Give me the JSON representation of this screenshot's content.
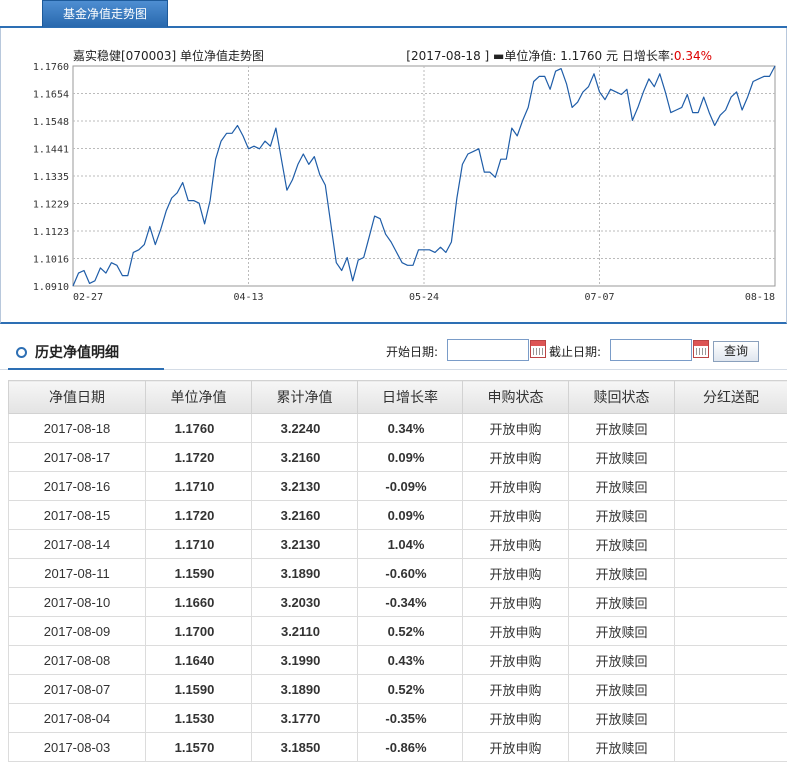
{
  "tab": {
    "label": "基金净值走势图"
  },
  "chart_header": {
    "title": "嘉实稳健[070003] 单位净值走势图",
    "info_prefix": "[2017-08-18 ] ▬单位净值: 1.1760 元  日增长率:",
    "info_rate": "0.34%"
  },
  "chart_data": {
    "type": "line",
    "title": "嘉实稳健[070003] 单位净值走势图",
    "ylim": [
      1.091,
      1.176
    ],
    "y_ticks": [
      "1.1760",
      "1.1654",
      "1.1548",
      "1.1441",
      "1.1335",
      "1.1229",
      "1.1123",
      "1.1016",
      "1.0910"
    ],
    "x_ticks": [
      "02-27",
      "04-13",
      "05-24",
      "07-07",
      "08-18"
    ],
    "grid": true,
    "series": [
      {
        "name": "单位净值",
        "color": "#1f5da8",
        "values": [
          1.091,
          1.096,
          1.097,
          1.092,
          1.093,
          1.098,
          1.096,
          1.1,
          1.099,
          1.095,
          1.095,
          1.104,
          1.105,
          1.107,
          1.114,
          1.107,
          1.113,
          1.12,
          1.125,
          1.127,
          1.131,
          1.124,
          1.124,
          1.123,
          1.115,
          1.124,
          1.14,
          1.147,
          1.15,
          1.15,
          1.153,
          1.149,
          1.144,
          1.145,
          1.144,
          1.147,
          1.145,
          1.152,
          1.14,
          1.128,
          1.132,
          1.138,
          1.142,
          1.138,
          1.141,
          1.134,
          1.13,
          1.115,
          1.1,
          1.097,
          1.102,
          1.093,
          1.101,
          1.102,
          1.11,
          1.118,
          1.117,
          1.111,
          1.108,
          1.104,
          1.1,
          1.099,
          1.099,
          1.105,
          1.105,
          1.105,
          1.104,
          1.106,
          1.104,
          1.108,
          1.125,
          1.138,
          1.142,
          1.143,
          1.144,
          1.135,
          1.135,
          1.133,
          1.14,
          1.14,
          1.152,
          1.149,
          1.155,
          1.16,
          1.17,
          1.172,
          1.172,
          1.167,
          1.174,
          1.175,
          1.169,
          1.16,
          1.162,
          1.166,
          1.168,
          1.173,
          1.166,
          1.163,
          1.167,
          1.166,
          1.165,
          1.167,
          1.155,
          1.16,
          1.166,
          1.171,
          1.168,
          1.173,
          1.166,
          1.158,
          1.159,
          1.16,
          1.165,
          1.158,
          1.158,
          1.164,
          1.158,
          1.153,
          1.157,
          1.159,
          1.164,
          1.166,
          1.159,
          1.164,
          1.17,
          1.171,
          1.172,
          1.172,
          1.176
        ]
      }
    ]
  },
  "history": {
    "title": "历史净值明细",
    "start_label": "开始日期:",
    "end_label": "截止日期:",
    "start_value": "",
    "end_value": "",
    "query_label": "查询",
    "columns": [
      "净值日期",
      "单位净值",
      "累计净值",
      "日增长率",
      "申购状态",
      "赎回状态",
      "分红送配"
    ],
    "rows": [
      {
        "date": "2017-08-18",
        "nav": "1.1760",
        "acc": "3.2240",
        "rate": "0.34%",
        "dir": "up",
        "buy": "开放申购",
        "sell": "开放赎回",
        "div": ""
      },
      {
        "date": "2017-08-17",
        "nav": "1.1720",
        "acc": "3.2160",
        "rate": "0.09%",
        "dir": "up",
        "buy": "开放申购",
        "sell": "开放赎回",
        "div": ""
      },
      {
        "date": "2017-08-16",
        "nav": "1.1710",
        "acc": "3.2130",
        "rate": "-0.09%",
        "dir": "down",
        "buy": "开放申购",
        "sell": "开放赎回",
        "div": ""
      },
      {
        "date": "2017-08-15",
        "nav": "1.1720",
        "acc": "3.2160",
        "rate": "0.09%",
        "dir": "up",
        "buy": "开放申购",
        "sell": "开放赎回",
        "div": ""
      },
      {
        "date": "2017-08-14",
        "nav": "1.1710",
        "acc": "3.2130",
        "rate": "1.04%",
        "dir": "up",
        "buy": "开放申购",
        "sell": "开放赎回",
        "div": ""
      },
      {
        "date": "2017-08-11",
        "nav": "1.1590",
        "acc": "3.1890",
        "rate": "-0.60%",
        "dir": "down",
        "buy": "开放申购",
        "sell": "开放赎回",
        "div": ""
      },
      {
        "date": "2017-08-10",
        "nav": "1.1660",
        "acc": "3.2030",
        "rate": "-0.34%",
        "dir": "down",
        "buy": "开放申购",
        "sell": "开放赎回",
        "div": ""
      },
      {
        "date": "2017-08-09",
        "nav": "1.1700",
        "acc": "3.2110",
        "rate": "0.52%",
        "dir": "up",
        "buy": "开放申购",
        "sell": "开放赎回",
        "div": ""
      },
      {
        "date": "2017-08-08",
        "nav": "1.1640",
        "acc": "3.1990",
        "rate": "0.43%",
        "dir": "up",
        "buy": "开放申购",
        "sell": "开放赎回",
        "div": ""
      },
      {
        "date": "2017-08-07",
        "nav": "1.1590",
        "acc": "3.1890",
        "rate": "0.52%",
        "dir": "up",
        "buy": "开放申购",
        "sell": "开放赎回",
        "div": ""
      },
      {
        "date": "2017-08-04",
        "nav": "1.1530",
        "acc": "3.1770",
        "rate": "-0.35%",
        "dir": "down",
        "buy": "开放申购",
        "sell": "开放赎回",
        "div": ""
      },
      {
        "date": "2017-08-03",
        "nav": "1.1570",
        "acc": "3.1850",
        "rate": "-0.86%",
        "dir": "down",
        "buy": "开放申购",
        "sell": "开放赎回",
        "div": ""
      }
    ]
  }
}
